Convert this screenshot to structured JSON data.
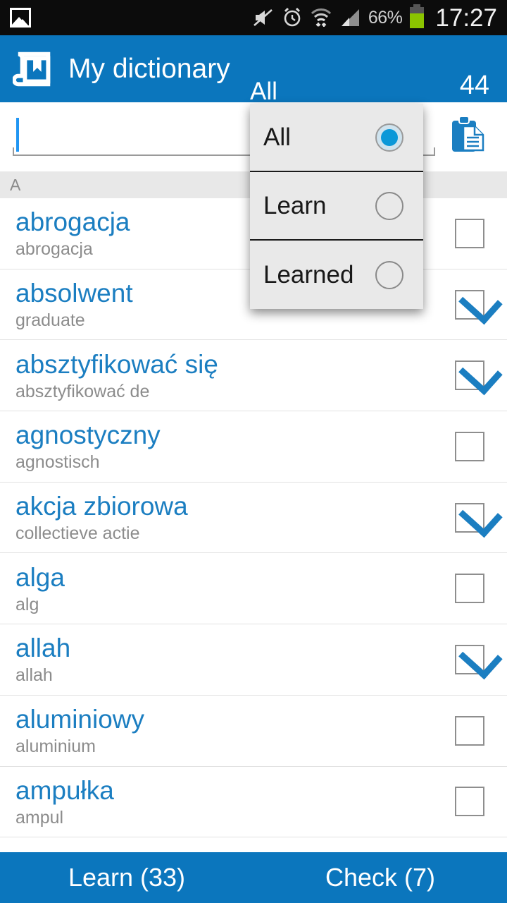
{
  "status_bar": {
    "left_icon": "gallery-icon",
    "icons": [
      "mute-icon",
      "alarm-icon",
      "wifi-icon",
      "signal-icon"
    ],
    "battery_percent": "66%",
    "time": "17:27"
  },
  "action_bar": {
    "app_icon": "book-bookmark-icon",
    "title": "My dictionary",
    "spinner_value": "All",
    "count": "44"
  },
  "search": {
    "value": "",
    "placeholder": "",
    "clipboard_icon": "clipboard-icon"
  },
  "dropdown": {
    "open": true,
    "options": [
      {
        "label": "All",
        "selected": true
      },
      {
        "label": "Learn",
        "selected": false
      },
      {
        "label": "Learned",
        "selected": false
      }
    ]
  },
  "list": {
    "section_header": "A",
    "rows": [
      {
        "term": "abrogacja",
        "translation": "abrogacja",
        "checked": false
      },
      {
        "term": "absolwent",
        "translation": "graduate",
        "checked": true
      },
      {
        "term": "absztyfikować się",
        "translation": "absztyfikować de",
        "checked": true
      },
      {
        "term": "agnostyczny",
        "translation": "agnostisch",
        "checked": false
      },
      {
        "term": "akcja zbiorowa",
        "translation": "collectieve actie",
        "checked": true
      },
      {
        "term": "alga",
        "translation": "alg",
        "checked": false
      },
      {
        "term": "allah",
        "translation": "allah",
        "checked": true
      },
      {
        "term": "aluminiowy",
        "translation": "aluminium",
        "checked": false
      },
      {
        "term": "ampułka",
        "translation": "ampul",
        "checked": false
      }
    ]
  },
  "bottom_bar": {
    "learn_label": "Learn (33)",
    "check_label": "Check (7)"
  },
  "colors": {
    "brand_blue": "#0b76bd",
    "term_blue": "#1b7ec1",
    "status_bar": "#0c0c0c",
    "section_bg": "#e8e8e8",
    "dropdown_bg": "#e9e9e9",
    "battery_green": "#8bc400"
  }
}
